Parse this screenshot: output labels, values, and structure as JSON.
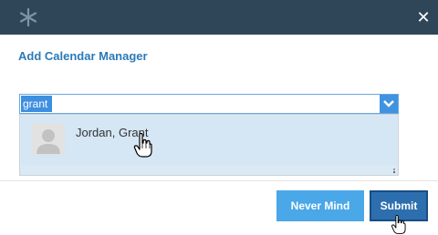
{
  "window": {
    "app_icon": "snowflake-icon",
    "close_icon": "close-icon",
    "close_symbol": "✕"
  },
  "dialog": {
    "title": "Add Calendar Manager"
  },
  "search": {
    "value": "grant",
    "dropdown_icon": "chevron-down-icon"
  },
  "results": [
    {
      "name": "Jordan, Grant",
      "avatar": "user-avatar-icon"
    }
  ],
  "footer": {
    "never_mind_label": "Never Mind",
    "submit_label": "Submit"
  },
  "colors": {
    "titlebar": "#2f4658",
    "accent": "#2a7ab8",
    "button_light": "#4aa7e8",
    "button_primary": "#2d6fae",
    "selection": "#d5e6f5"
  }
}
